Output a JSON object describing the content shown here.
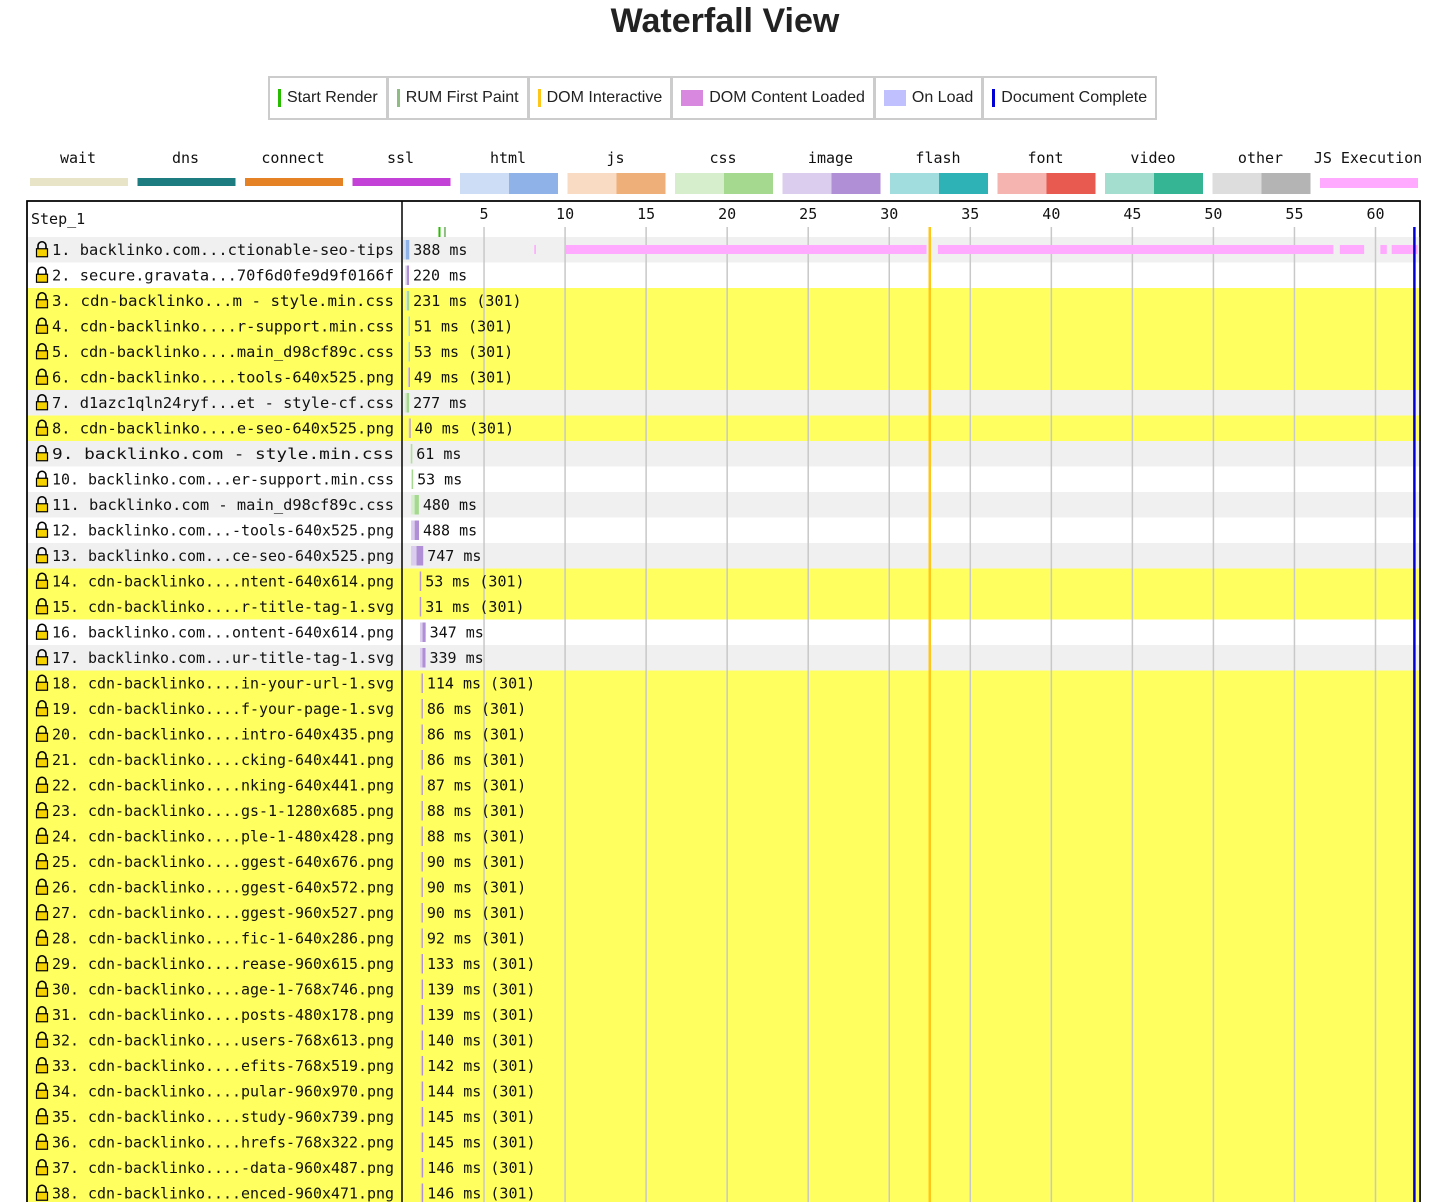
{
  "page": {
    "title": "Waterfall View"
  },
  "legend": [
    {
      "label": "Start Render",
      "color": "#28bc00",
      "kind": "line"
    },
    {
      "label": "RUM First Paint",
      "color": "#8fbc83",
      "kind": "line"
    },
    {
      "label": "DOM Interactive",
      "color": "#ffc61a",
      "kind": "line"
    },
    {
      "label": "DOM Content Loaded",
      "color": "#d888df",
      "kind": "box"
    },
    {
      "label": "On Load",
      "color": "#c0c0ff",
      "kind": "box"
    },
    {
      "label": "Document Complete",
      "color": "#0000d6",
      "kind": "line"
    }
  ],
  "chart_data": {
    "type": "waterfall",
    "step_label": "Step_1",
    "x_axis": {
      "unit": "s",
      "ticks": [
        5,
        10,
        15,
        20,
        25,
        30,
        35,
        40,
        45,
        50,
        55,
        60
      ],
      "range": [
        0,
        62.6
      ]
    },
    "timing_lines": {
      "start_render": 2.25,
      "rum_first_paint": 2.4,
      "dom_interactive": 32.5,
      "document_complete": 62.4
    },
    "request_types": [
      {
        "name": "wait",
        "color": "#e8e4c8"
      },
      {
        "name": "dns",
        "color": "#1c7c80"
      },
      {
        "name": "connect",
        "color": "#e58226"
      },
      {
        "name": "ssl",
        "color": "#c441d7"
      },
      {
        "name": "html",
        "color": "#8fb3e8"
      },
      {
        "name": "js",
        "color": "#efaf78"
      },
      {
        "name": "css",
        "color": "#a5d990"
      },
      {
        "name": "image",
        "color": "#b08fd6"
      },
      {
        "name": "flash",
        "color": "#2fb2b5"
      },
      {
        "name": "font",
        "color": "#e8594f"
      },
      {
        "name": "video",
        "color": "#35b593"
      },
      {
        "name": "other",
        "color": "#b4b4b4"
      },
      {
        "name": "JS Execution",
        "color": "#ffaaff"
      }
    ],
    "js_execution": [
      [
        8.1,
        8.2
      ],
      [
        10.0,
        32.3
      ],
      [
        33.0,
        57.4
      ],
      [
        57.8,
        59.3
      ],
      [
        60.3,
        60.7
      ],
      [
        61.0,
        62.6
      ]
    ],
    "requests": [
      {
        "label": "1. backlinko.com...ctionable-seo-tips",
        "start": 0.0,
        "dur": 0.388,
        "type": "html",
        "time": "388 ms",
        "redirect": false
      },
      {
        "label": "2. secure.gravata...70f6d0fe9d9f0166f",
        "start": 0.15,
        "dur": 0.22,
        "type": "image",
        "time": "220 ms",
        "redirect": false
      },
      {
        "label": "3. cdn-backlinko...m - style.min.css",
        "start": 0.15,
        "dur": 0.231,
        "type": "css",
        "time": "231 ms (301)",
        "redirect": true
      },
      {
        "label": "4. cdn-backlinko....r-support.min.css",
        "start": 0.3,
        "dur": 0.051,
        "type": "css",
        "time": "51 ms (301)",
        "redirect": true
      },
      {
        "label": "5. cdn-backlinko....main_d98cf89c.css",
        "start": 0.3,
        "dur": 0.053,
        "type": "css",
        "time": "53 ms (301)",
        "redirect": true
      },
      {
        "label": "6. cdn-backlinko....tools-640x525.png",
        "start": 0.3,
        "dur": 0.049,
        "type": "image",
        "time": "49 ms (301)",
        "redirect": true
      },
      {
        "label": "7. d1azc1qln24ryf...et - style-cf.css",
        "start": 0.1,
        "dur": 0.277,
        "type": "css",
        "time": "277 ms",
        "redirect": false
      },
      {
        "label": "8. cdn-backlinko....e-seo-640x525.png",
        "start": 0.35,
        "dur": 0.04,
        "type": "image",
        "time": "40 ms (301)",
        "redirect": true
      },
      {
        "label": "9. backlinko.com - style.min.css",
        "start": 0.45,
        "dur": 0.061,
        "type": "css",
        "time": "61 ms",
        "redirect": false
      },
      {
        "label": "10. backlinko.com...er-support.min.css",
        "start": 0.5,
        "dur": 0.053,
        "type": "css",
        "time": "53 ms",
        "redirect": false
      },
      {
        "label": "11. backlinko.com - main_d98cf89c.css",
        "start": 0.5,
        "dur": 0.48,
        "type": "css",
        "time": "480 ms",
        "redirect": false
      },
      {
        "label": "12. backlinko.com...-tools-640x525.png",
        "start": 0.5,
        "dur": 0.488,
        "type": "image",
        "time": "488 ms",
        "redirect": false
      },
      {
        "label": "13. backlinko.com...ce-seo-640x525.png",
        "start": 0.5,
        "dur": 0.747,
        "type": "image",
        "time": "747 ms",
        "redirect": false
      },
      {
        "label": "14. cdn-backlinko....ntent-640x614.png",
        "start": 1.0,
        "dur": 0.053,
        "type": "image",
        "time": "53 ms (301)",
        "redirect": true
      },
      {
        "label": "15. cdn-backlinko....r-title-tag-1.svg",
        "start": 1.0,
        "dur": 0.031,
        "type": "image",
        "time": "31 ms (301)",
        "redirect": true
      },
      {
        "label": "16. backlinko.com...ontent-640x614.png",
        "start": 1.05,
        "dur": 0.347,
        "type": "image",
        "time": "347 ms",
        "redirect": false
      },
      {
        "label": "17. backlinko.com...ur-title-tag-1.svg",
        "start": 1.05,
        "dur": 0.339,
        "type": "image",
        "time": "339 ms",
        "redirect": false
      },
      {
        "label": "18. cdn-backlinko....in-your-url-1.svg",
        "start": 1.1,
        "dur": 0.114,
        "type": "image",
        "time": "114 ms (301)",
        "redirect": true
      },
      {
        "label": "19. cdn-backlinko....f-your-page-1.svg",
        "start": 1.1,
        "dur": 0.086,
        "type": "image",
        "time": "86 ms (301)",
        "redirect": true
      },
      {
        "label": "20. cdn-backlinko....intro-640x435.png",
        "start": 1.1,
        "dur": 0.086,
        "type": "image",
        "time": "86 ms (301)",
        "redirect": true
      },
      {
        "label": "21. cdn-backlinko....cking-640x441.png",
        "start": 1.1,
        "dur": 0.086,
        "type": "image",
        "time": "86 ms (301)",
        "redirect": true
      },
      {
        "label": "22. cdn-backlinko....nking-640x441.png",
        "start": 1.1,
        "dur": 0.087,
        "type": "image",
        "time": "87 ms (301)",
        "redirect": true
      },
      {
        "label": "23. cdn-backlinko....gs-1-1280x685.png",
        "start": 1.1,
        "dur": 0.088,
        "type": "image",
        "time": "88 ms (301)",
        "redirect": true
      },
      {
        "label": "24. cdn-backlinko....ple-1-480x428.png",
        "start": 1.1,
        "dur": 0.088,
        "type": "image",
        "time": "88 ms (301)",
        "redirect": true
      },
      {
        "label": "25. cdn-backlinko....ggest-640x676.png",
        "start": 1.1,
        "dur": 0.09,
        "type": "image",
        "time": "90 ms (301)",
        "redirect": true
      },
      {
        "label": "26. cdn-backlinko....ggest-640x572.png",
        "start": 1.1,
        "dur": 0.09,
        "type": "image",
        "time": "90 ms (301)",
        "redirect": true
      },
      {
        "label": "27. cdn-backlinko....ggest-960x527.png",
        "start": 1.1,
        "dur": 0.09,
        "type": "image",
        "time": "90 ms (301)",
        "redirect": true
      },
      {
        "label": "28. cdn-backlinko....fic-1-640x286.png",
        "start": 1.1,
        "dur": 0.092,
        "type": "image",
        "time": "92 ms (301)",
        "redirect": true
      },
      {
        "label": "29. cdn-backlinko....rease-960x615.png",
        "start": 1.1,
        "dur": 0.133,
        "type": "image",
        "time": "133 ms (301)",
        "redirect": true
      },
      {
        "label": "30. cdn-backlinko....age-1-768x746.png",
        "start": 1.1,
        "dur": 0.139,
        "type": "image",
        "time": "139 ms (301)",
        "redirect": true
      },
      {
        "label": "31. cdn-backlinko....posts-480x178.png",
        "start": 1.1,
        "dur": 0.139,
        "type": "image",
        "time": "139 ms (301)",
        "redirect": true
      },
      {
        "label": "32. cdn-backlinko....users-768x613.png",
        "start": 1.1,
        "dur": 0.14,
        "type": "image",
        "time": "140 ms (301)",
        "redirect": true
      },
      {
        "label": "33. cdn-backlinko....efits-768x519.png",
        "start": 1.1,
        "dur": 0.142,
        "type": "image",
        "time": "142 ms (301)",
        "redirect": true
      },
      {
        "label": "34. cdn-backlinko....pular-960x970.png",
        "start": 1.1,
        "dur": 0.144,
        "type": "image",
        "time": "144 ms (301)",
        "redirect": true
      },
      {
        "label": "35. cdn-backlinko....study-960x739.png",
        "start": 1.1,
        "dur": 0.145,
        "type": "image",
        "time": "145 ms (301)",
        "redirect": true
      },
      {
        "label": "36. cdn-backlinko....hrefs-768x322.png",
        "start": 1.1,
        "dur": 0.145,
        "type": "image",
        "time": "145 ms (301)",
        "redirect": true
      },
      {
        "label": "37. cdn-backlinko....-data-960x487.png",
        "start": 1.1,
        "dur": 0.146,
        "type": "image",
        "time": "146 ms (301)",
        "redirect": true
      },
      {
        "label": "38. cdn-backlinko....enced-960x471.png",
        "start": 1.1,
        "dur": 0.146,
        "type": "image",
        "time": "146 ms (301)",
        "redirect": true
      }
    ]
  }
}
